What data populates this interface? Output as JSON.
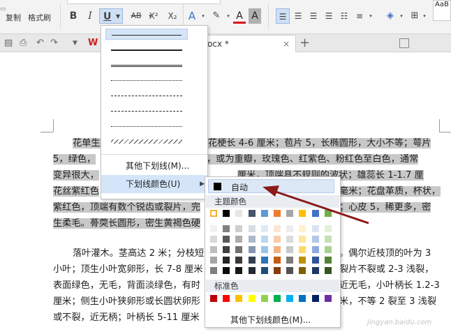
{
  "ribbon": {
    "copy_label": "复制",
    "format_painter_label": "格式刷",
    "bold": "B",
    "italic": "I",
    "underline": "U",
    "strike": "AB",
    "superscript": "X²",
    "subscript": "X₂",
    "text_effect": "A",
    "font_color": "A",
    "char_shading": "A",
    "style_preview": "AaB"
  },
  "tab_bar": {
    "doc_tab_label": "ocx *"
  },
  "underline_menu": {
    "more_underlines": "其他下划线(M)...",
    "underline_color": "下划线颜色(U)"
  },
  "color_menu": {
    "auto_label": "自动",
    "theme_colors_label": "主题颜色",
    "standard_colors_label": "标准色",
    "more_colors_label": "其他下划线颜色(M)...",
    "theme_top": [
      "#ffffff",
      "#000000",
      "#e7e6e6",
      "#44546a",
      "#5b9bd5",
      "#ed7d31",
      "#a5a5a5",
      "#ffc000",
      "#4472c4",
      "#70ad47"
    ],
    "theme_shades": [
      [
        "#f2f2f2",
        "#808080",
        "#d0cece",
        "#d6dce5",
        "#deebf7",
        "#fbe5d6",
        "#ededed",
        "#fff2cc",
        "#dae3f3",
        "#e2f0d9"
      ],
      [
        "#d9d9d9",
        "#595959",
        "#aeabab",
        "#adb9ca",
        "#bdd7ee",
        "#f8cbad",
        "#dbdbdb",
        "#ffe699",
        "#b4c7e7",
        "#c5e0b4"
      ],
      [
        "#bfbfbf",
        "#404040",
        "#757171",
        "#8497b0",
        "#9dc3e6",
        "#f4b183",
        "#c9c9c9",
        "#ffd966",
        "#8faadc",
        "#a9d18e"
      ],
      [
        "#a6a6a6",
        "#262626",
        "#3b3838",
        "#333f50",
        "#2e75b6",
        "#c55a11",
        "#7b7b7b",
        "#bf9000",
        "#2f5597",
        "#538135"
      ],
      [
        "#7f7f7f",
        "#0d0d0d",
        "#171616",
        "#222a35",
        "#1f4e79",
        "#843c0c",
        "#525252",
        "#7f6000",
        "#203864",
        "#375623"
      ]
    ],
    "standard": [
      "#c00000",
      "#ff0000",
      "#ffc000",
      "#ffff00",
      "#92d050",
      "#00b050",
      "#00b0f0",
      "#0070c0",
      "#002060",
      "#7030a0"
    ]
  },
  "document": {
    "p1": [
      "花单生",
      "花梗长 4-6 厘米；苞片 5，长椭圆形，大小不等；萼片",
      "5，绿色，",
      "，或为重瓣，玫瑰色、红紫色、粉红色至白色，通常",
      "变异很大，",
      "厘米，顶端具不规则的波状；雄蕊长 1-1.7 厘米，",
      "花丝紫红色",
      "毫米；花盘革质，杯状，",
      "紫红色，顶端有数个锐齿或裂片，完",
      "；心皮 5，稀更多，密",
      "生柔毛。蓇葖长圆形，密生黄褐色硬"
    ],
    "p2": [
      "落叶灌木。茎高达 2 米；分枝短",
      "。偶尔近枝顶的叶为 3",
      "小叶；顶生小叶宽卵形，长 7-8 厘米",
      "裂片不裂或 2-3 浅裂，",
      "表面绿色，无毛，背面淡绿色，有时",
      "近无毛，小叶柄长 1.2-3",
      "厘米；侧生小叶狭卵形或长圆状卵形",
      "米，不等 2 裂至 3 浅裂",
      "或不裂，近无柄；叶柄长 5-11 厘米"
    ]
  },
  "colors": {
    "annotation_arrow": "#8b1a1a",
    "selection": "#c8c8c8",
    "menu_highlight": "#d4e5fa"
  },
  "watermark": "jingyan.baidu.com"
}
